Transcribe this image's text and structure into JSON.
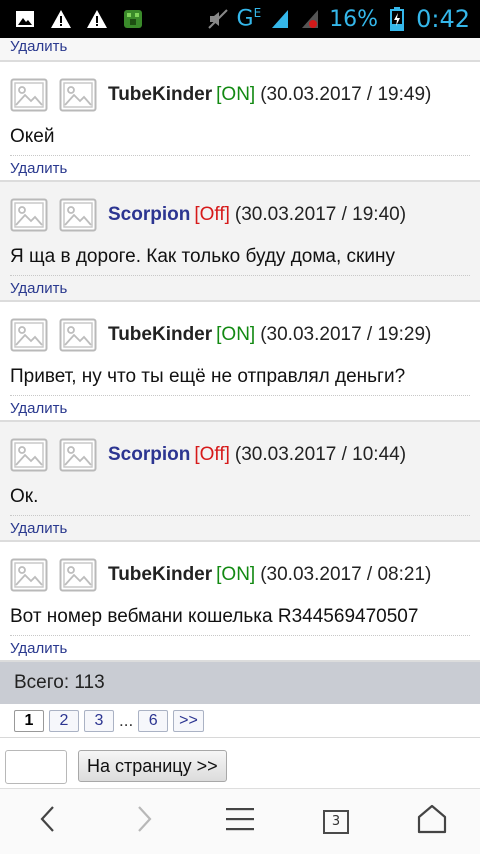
{
  "status_bar": {
    "network": "G",
    "network_sub": "E",
    "battery_percent": "16%",
    "time": "0:42",
    "icons": [
      "image-icon",
      "warning-icon",
      "warning-icon",
      "app-icon",
      "mute-icon",
      "signal-icon",
      "signal-no-sim-icon",
      "battery-charging-icon"
    ]
  },
  "top_delete_label": "Удалить",
  "messages": [
    {
      "nick": "TubeKinder",
      "status": "[ON]",
      "date": "(30.03.2017 / 19:49)",
      "text": "Окей",
      "delete": "Удалить"
    },
    {
      "nick": "Scorpion",
      "status": "[Off]",
      "date": "(30.03.2017 / 19:40)",
      "text": "Я ща в дороге. Как только буду дома, скину",
      "delete": "Удалить"
    },
    {
      "nick": "TubeKinder",
      "status": "[ON]",
      "date": "(30.03.2017 / 19:29)",
      "text": "Привет, ну что ты ещё не отправлял деньги?",
      "delete": "Удалить"
    },
    {
      "nick": "Scorpion",
      "status": "[Off]",
      "date": "(30.03.2017 / 10:44)",
      "text": "Ок.",
      "delete": "Удалить"
    },
    {
      "nick": "TubeKinder",
      "status": "[ON]",
      "date": "(30.03.2017 / 08:21)",
      "text": "Вот номер вебмани кошелька R344569470507",
      "delete": "Удалить"
    }
  ],
  "total_label": "Всего: 113",
  "pagination": {
    "pages": [
      "1",
      "2",
      "3"
    ],
    "ellipsis": "...",
    "last": "6",
    "next": ">>",
    "current": "1"
  },
  "goto": {
    "input_value": "",
    "button_label": "На страницу >>"
  },
  "navbar": {
    "tab_count": "3",
    "icons": [
      "back-icon",
      "forward-icon",
      "menu-icon",
      "tabs-icon",
      "home-icon"
    ]
  },
  "colors": {
    "status_on": "#138a13",
    "status_off": "#d61a1a",
    "nick_scorpion": "#2c3591",
    "link": "#2b3a8f",
    "status_bar_accent": "#35b7ea"
  }
}
